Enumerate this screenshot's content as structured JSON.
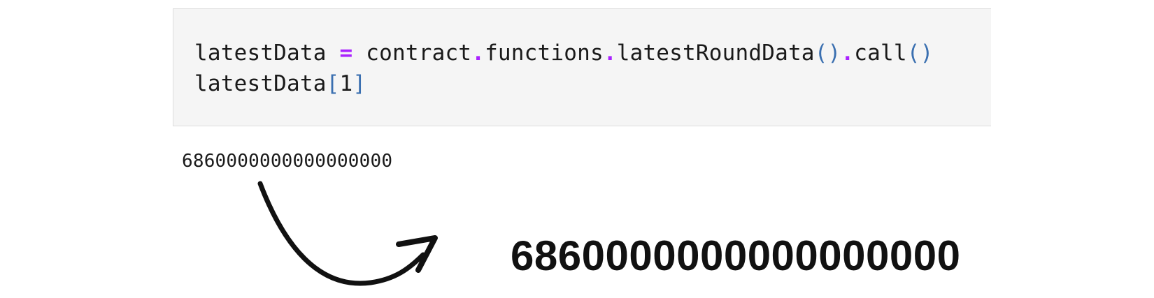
{
  "code_cell": {
    "line1": {
      "var": "latestData",
      "op": "=",
      "obj": "contract",
      "dot1": ".",
      "attr1": "functions",
      "dot2": ".",
      "method": "latestRoundData",
      "parens1": "()",
      "dot3": ".",
      "call": "call",
      "parens2": "()"
    },
    "line2": {
      "var": "latestData",
      "open_bracket": "[",
      "index": "1",
      "close_bracket": "]"
    }
  },
  "output": {
    "value": "6860000000000000000"
  },
  "annotation": {
    "big_value": "6860000000000000000",
    "arrow_icon": "curved-arrow-icon"
  }
}
